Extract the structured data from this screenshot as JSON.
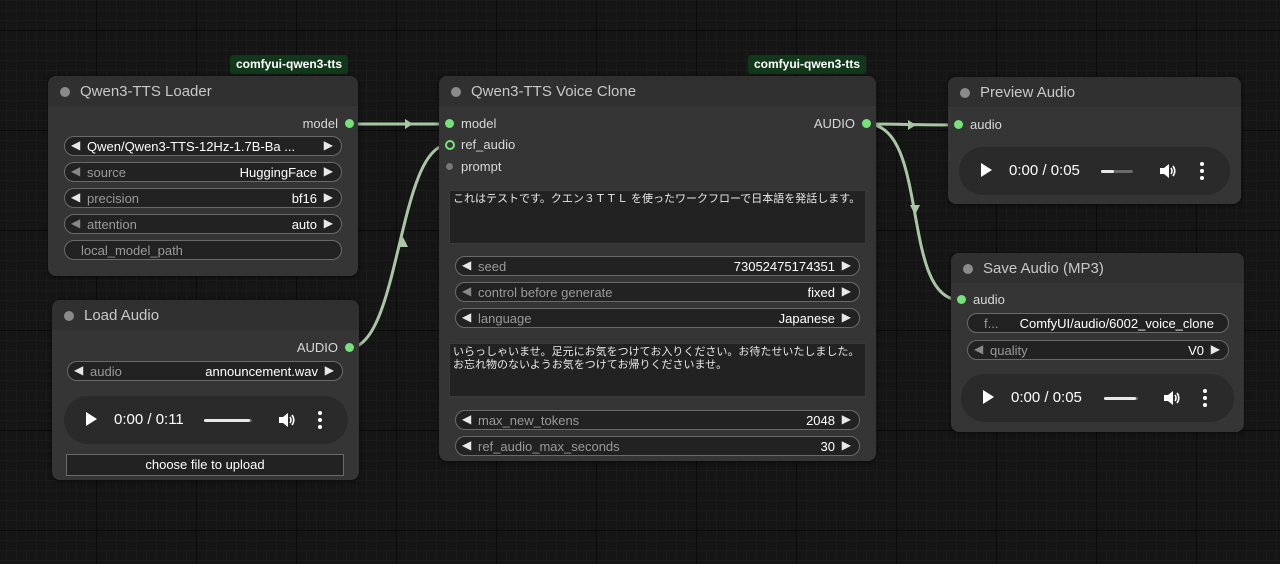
{
  "colors": {
    "canvas_bg": "#151515",
    "node_bg": "#353535",
    "node_title_bg": "#303030",
    "badge_bg": "#11381a",
    "link": "#a9c7a5",
    "slot_connected": "#75e27a"
  },
  "nodes": {
    "loader": {
      "badge": "comfyui-qwen3-tts",
      "title": "Qwen3-TTS Loader",
      "outputs": [
        "model"
      ],
      "widgets": [
        {
          "label": "",
          "value": "Qwen/Qwen3-TTS-12Hz-1.7B-Ba ..."
        },
        {
          "label": "source",
          "value": "HuggingFace"
        },
        {
          "label": "precision",
          "value": "bf16"
        },
        {
          "label": "attention",
          "value": "auto"
        },
        {
          "label": "local_model_path",
          "value": ""
        }
      ]
    },
    "load_audio": {
      "title": "Load Audio",
      "outputs": [
        "AUDIO"
      ],
      "widgets": [
        {
          "label": "audio",
          "value": "announcement.wav"
        }
      ],
      "player": {
        "time": "0:00 / 0:11",
        "volume_level": 0.95
      },
      "upload_label": "choose file to upload"
    },
    "voice_clone": {
      "badge": "comfyui-qwen3-tts",
      "title": "Qwen3-TTS Voice Clone",
      "inputs": [
        "model",
        "ref_audio",
        "prompt"
      ],
      "outputs": [
        "AUDIO"
      ],
      "text1": "これはテストです。クエン３ＴＴＬ を使ったワークフローで日本語を発話します。",
      "widgets_a": [
        {
          "label": "seed",
          "value": "73052475174351"
        },
        {
          "label": "control before generate",
          "value": "fixed"
        },
        {
          "label": "language",
          "value": "Japanese"
        }
      ],
      "text2": "いらっしゃいませ。足元にお気をつけてお入りください。お待たせいたしました。\nお忘れ物のないようお気をつけてお帰りくださいませ。",
      "widgets_b": [
        {
          "label": "max_new_tokens",
          "value": "2048"
        },
        {
          "label": "ref_audio_max_seconds",
          "value": "30"
        }
      ]
    },
    "preview_audio": {
      "title": "Preview Audio",
      "inputs": [
        "audio"
      ],
      "player": {
        "time": "0:00 / 0:05",
        "volume_level": 0.4
      }
    },
    "save_audio": {
      "title": "Save Audio (MP3)",
      "inputs": [
        "audio"
      ],
      "widgets": [
        {
          "label": "f...",
          "value": "ComfyUI/audio/6002_voice_clone"
        },
        {
          "label": "quality",
          "value": "V0"
        }
      ],
      "player": {
        "time": "0:00 / 0:05",
        "volume_level": 0.95
      }
    }
  }
}
